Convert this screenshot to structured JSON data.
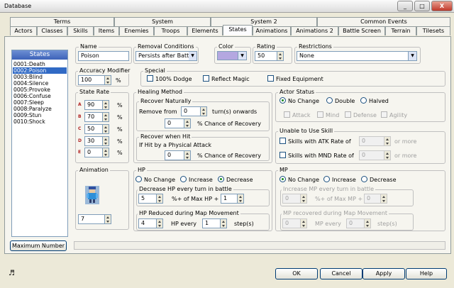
{
  "window": {
    "title": "Database",
    "minimize": "_",
    "maximize": "□",
    "close": "X"
  },
  "tabs_row1": [
    "Terms",
    "System",
    "System 2",
    "Common Events"
  ],
  "tabs_row2": [
    "Actors",
    "Classes",
    "Skills",
    "Items",
    "Enemies",
    "Troops",
    "Elements",
    "States",
    "Animations",
    "Animations 2",
    "Battle Screen",
    "Terrain",
    "Tilesets"
  ],
  "states_list": {
    "header": "States",
    "items": [
      "0001:Death",
      "0002:Poison",
      "0003:Blind",
      "0004:Silence",
      "0005:Provoke",
      "0006:Confuse",
      "0007:Sleep",
      "0008:Paralyze",
      "0009:Stun",
      "0010:Shock"
    ],
    "selected_index": 1
  },
  "max_number_btn": "Maximum Number",
  "name": {
    "label": "Name",
    "value": "Poison"
  },
  "removal": {
    "label": "Removal Conditions",
    "value": "Persists after Battle"
  },
  "color": {
    "label": "Color",
    "swatch": "#b4a7e0"
  },
  "rating": {
    "label": "Rating",
    "value": "50"
  },
  "restrictions": {
    "label": "Restrictions",
    "value": "None"
  },
  "accuracy": {
    "label": "Accuracy Modifier",
    "value": "100",
    "unit": "%"
  },
  "special": {
    "label": "Special",
    "dodge": "100% Dodge",
    "reflect": "Reflect Magic",
    "fixed": "Fixed Equipment"
  },
  "state_rate": {
    "label": "State Rate",
    "rows": [
      {
        "l": "A",
        "v": "90"
      },
      {
        "l": "B",
        "v": "70"
      },
      {
        "l": "C",
        "v": "50"
      },
      {
        "l": "D",
        "v": "30"
      },
      {
        "l": "E",
        "v": "0"
      }
    ],
    "unit": "%"
  },
  "healing": {
    "label": "Healing Method",
    "recover_naturally": "Recover Naturally",
    "remove_from": "Remove from",
    "turn_value": "0",
    "turn_onwards": "turn(s) onwards",
    "pct_value": "0",
    "chance": "% Chance of Recovery",
    "recover_hit": "Recover when Hit",
    "if_hit": "If Hit by a Physical Attack",
    "hit_pct": "0",
    "hit_chance": "% Chance of Recovery"
  },
  "actor_status": {
    "label": "Actor Status",
    "no_change": "No Change",
    "double": "Double",
    "halved": "Halved",
    "attack": "Attack",
    "mind": "Mind",
    "defense": "Defense",
    "agility": "Agility"
  },
  "unable_skill": {
    "label": "Unable to Use Skill",
    "atk": "Skills with ATK Rate of",
    "atk_val": "0",
    "mnd": "Skills with MND Rate of",
    "mnd_val": "0",
    "or_more": "or more"
  },
  "animation": {
    "label": "Animation",
    "value": "7"
  },
  "hp": {
    "label": "HP",
    "no_change": "No Change",
    "increase": "Increase",
    "decrease": "Decrease",
    "decrease_label": "Decrease HP every turn in battle",
    "pct": "5",
    "pct_text": "%+ of Max HP +",
    "flat": "1",
    "map_label": "HP Reduced during Map Movement",
    "map_hp": "4",
    "hp_every": "HP every",
    "steps": "1",
    "steps_text": "step(s)"
  },
  "mp": {
    "label": "MP",
    "no_change": "No Change",
    "increase": "Increase",
    "decrease": "Decrease",
    "inc_label": "Increase MP every turn in battle",
    "pct": "0",
    "pct_text": "%+ of Max MP +",
    "flat": "0",
    "map_label": "MP recovered during Map Movement",
    "map_mp": "0",
    "mp_every": "MP every",
    "steps": "0",
    "steps_text": "step(s)"
  },
  "footer": {
    "ok": "OK",
    "cancel": "Cancel",
    "apply": "Apply",
    "help": "Help",
    "music_icon": "♬"
  }
}
